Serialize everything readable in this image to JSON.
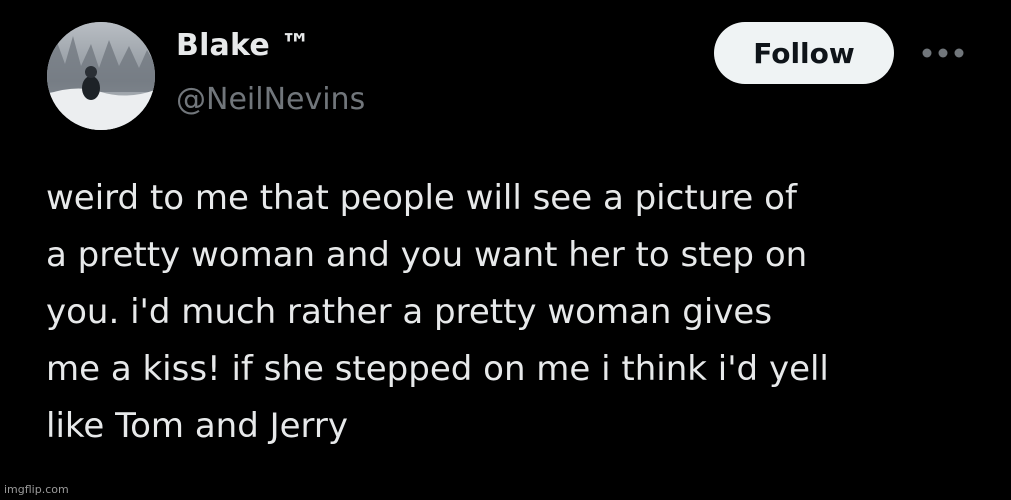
{
  "author": {
    "display_name": "Blake ™",
    "handle": "@NeilNevins"
  },
  "actions": {
    "follow_label": "Follow",
    "more_icon": "more-horizontal-icon"
  },
  "tweet": {
    "lines": [
      "weird to me that people will see a picture of",
      "a pretty woman and you want her to step on",
      "you. i'd much rather a pretty woman gives",
      "me a kiss! if she stepped on me i think i'd yell",
      "like Tom and Jerry"
    ]
  },
  "watermark": "imgflip.com",
  "colors": {
    "background": "#000000",
    "text_primary": "#e7e9ea",
    "text_secondary": "#71767b",
    "follow_bg": "#eff3f4",
    "follow_text": "#0f1419"
  }
}
